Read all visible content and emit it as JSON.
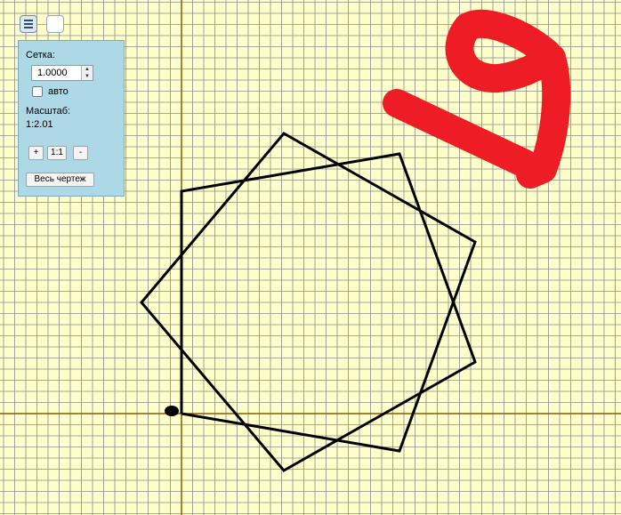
{
  "toolbar": {
    "menu_button_icon": "menu-icon",
    "blank_button_icon": "blank"
  },
  "panel": {
    "grid_label": "Сетка:",
    "grid_value": "1.0000",
    "auto_label": "авто",
    "auto_checked": false,
    "scale_label": "Масштаб:",
    "scale_value": "1:2.01",
    "zoom_in_label": "+",
    "zoom_reset_label": "1:1",
    "zoom_out_label": "-",
    "fit_all_label": "Весь чертеж"
  },
  "colors": {
    "background": "#ffffcc",
    "grid": "#8c8c8c",
    "axis": "#8b5a00",
    "drawing": "#000000",
    "annotation": "#ee1d25",
    "panel": "#add8e6"
  }
}
